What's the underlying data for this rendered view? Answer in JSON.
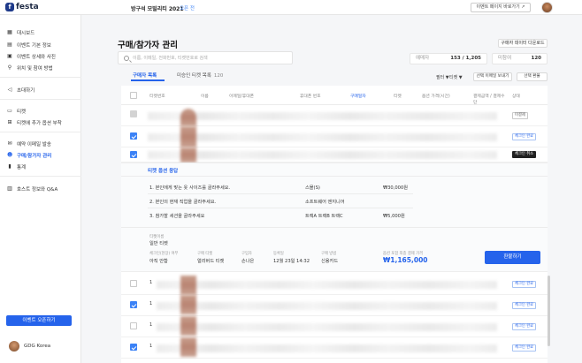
{
  "header": {
    "logo_text": "festa",
    "event_title": "방구석 모빌리티 2021",
    "event_status": "오픈 전",
    "preview_button": "이벤트 페이지 바로가기 ↗"
  },
  "sidebar": {
    "items": [
      {
        "label": "대시보드",
        "icon": "dashboard-icon"
      },
      {
        "label": "이벤트 기본 정보",
        "icon": "document-icon"
      },
      {
        "label": "이벤트 상세와 사진",
        "icon": "image-icon"
      },
      {
        "label": "위치 및 참여 방법",
        "icon": "pin-icon"
      },
      {
        "label": "초대하기",
        "icon": "megaphone-icon"
      },
      {
        "label": "티켓",
        "icon": "ticket-icon"
      },
      {
        "label": "티켓에 추가 옵션 부착",
        "icon": "plus-box-icon"
      },
      {
        "label": "예약 이메일 발송",
        "icon": "mail-icon"
      },
      {
        "label": "구매/참가자 관리",
        "icon": "people-icon"
      },
      {
        "label": "통계",
        "icon": "chart-icon"
      },
      {
        "label": "호스트 정보와 Q&A",
        "icon": "host-icon"
      }
    ],
    "create_button": "이벤트 오픈하기",
    "org_name": "GDG Korea"
  },
  "main": {
    "title": "구매/참가자 관리",
    "download_button": "구매자 데이터 다운로드",
    "search_placeholder": "이름, 이메일, 전화번호, 티켓번호로 검색",
    "stats": [
      {
        "label": "예매자",
        "value": "153 / 1,205"
      },
      {
        "label": "미참여",
        "value": "120"
      }
    ],
    "tabs": [
      {
        "label": "구매자 목록",
        "count": ""
      },
      {
        "label": "미승인 티켓 목록",
        "count": "120"
      }
    ],
    "filter_label": "필터 ▼",
    "filter_option": "티켓 ▼",
    "send_email_button": "선택 이메일 보내기",
    "refund_selected_button": "선택 환불",
    "columns": [
      "티켓번호",
      "이름",
      "이메일/휴대폰",
      "휴대폰 번호",
      "구매일자",
      "티켓",
      "옵션 가격(시간)",
      "결제금액 / 결제수단",
      "상태"
    ],
    "rows": [
      {
        "checked": false,
        "disabled": true,
        "status": "미결제",
        "style": "normal"
      },
      {
        "checked": true,
        "disabled": false,
        "status": "체크인 완료",
        "style": "blue"
      },
      {
        "checked": true,
        "disabled": false,
        "status": "체크인 취소",
        "style": "dark"
      }
    ],
    "expanded": {
      "title": "티켓 옵션 응답",
      "options": [
        {
          "question": "1. 본인에게 맞는 옷 사이즈를 골라주세요.",
          "answer": "스몰(S)",
          "price": "₩30,000원"
        },
        {
          "question": "2. 본인의 현재 직업을 골라주세요.",
          "answer": "소프트웨어 엔지니어",
          "price": ""
        },
        {
          "question": "3. 참가할 세션을 골라주세요",
          "answer": "트랙A   트랙B   트랙C",
          "price": "₩5,000원"
        }
      ],
      "ticket_label": "티켓이름",
      "ticket_value": "일반 티켓",
      "summary": [
        {
          "label": "체크인(현장) 여부",
          "value": "아직 안함"
        },
        {
          "label": "구매 티켓",
          "value": "얼리버드 티켓"
        },
        {
          "label": "구입자",
          "value": "손나은"
        },
        {
          "label": "등록일",
          "value": "12월 23일 14:32"
        },
        {
          "label": "구매 방법",
          "value": "신용카드"
        },
        {
          "label": "옵션 포함 최종 결제 가격",
          "value": "₩1,165,000"
        }
      ],
      "refund_button": "환불하기"
    },
    "lower_rows": [
      {
        "checked": false,
        "mark": "1",
        "status": "체크인 완료"
      },
      {
        "checked": true,
        "mark": "1",
        "status": "체크인 완료"
      },
      {
        "checked": false,
        "mark": "1",
        "status": "체크인 완료"
      },
      {
        "checked": true,
        "mark": "1",
        "status": "체크인 완료"
      }
    ]
  },
  "colors": {
    "accent": "#2563eb",
    "background": "#f5f6f8"
  }
}
